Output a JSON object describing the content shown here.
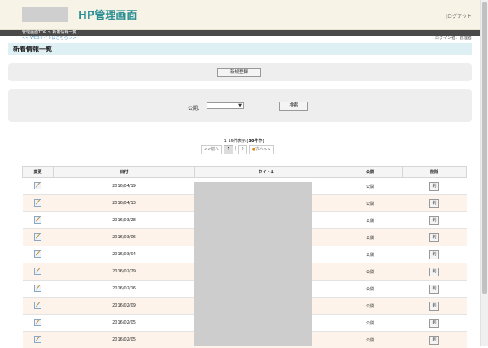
{
  "header": {
    "site_title": "HP管理画面",
    "logout": "|ログアウト"
  },
  "breadcrumb": "管理画面TOP > 新着情報一覧",
  "web_link": "<< WEBサイトはこちら >>",
  "login_user": "ログイン者：管理者",
  "page_title": "新着情報一覧",
  "new_button": "新規登録",
  "search": {
    "label": "公開：",
    "select_value": "",
    "button": "検索"
  },
  "pager": {
    "info_prefix": "1-15件表示 [",
    "info_total": "30件中",
    "info_suffix": "]",
    "prev": "<<前へ",
    "pages": [
      "1",
      "2"
    ],
    "current": "1",
    "separator": "|",
    "next": "次へ>>"
  },
  "table": {
    "headers": {
      "edit": "変更",
      "date": "日付",
      "title": "タイトル",
      "public": "公開",
      "delete": "削除"
    },
    "rows": [
      {
        "date": "2016/04/19",
        "status": "公開",
        "delete": "削"
      },
      {
        "date": "2016/04/13",
        "status": "公開",
        "delete": "削"
      },
      {
        "date": "2016/03/28",
        "status": "公開",
        "delete": "削"
      },
      {
        "date": "2016/03/06",
        "status": "公開",
        "delete": "削"
      },
      {
        "date": "2016/03/04",
        "status": "公開",
        "delete": "削"
      },
      {
        "date": "2016/02/29",
        "status": "公開",
        "delete": "削"
      },
      {
        "date": "2016/02/16",
        "status": "公開",
        "delete": "削"
      },
      {
        "date": "2016/02/09",
        "status": "公開",
        "delete": "削"
      },
      {
        "date": "2016/02/05",
        "status": "公開",
        "delete": "削"
      },
      {
        "date": "2016/02/05",
        "status": "公開",
        "delete": "削"
      }
    ]
  },
  "colors": {
    "accent": "#2b8f95",
    "header_bg": "#f7f3e6",
    "title_bar": "#dff0f4",
    "row_alt": "#fdf3ea"
  }
}
